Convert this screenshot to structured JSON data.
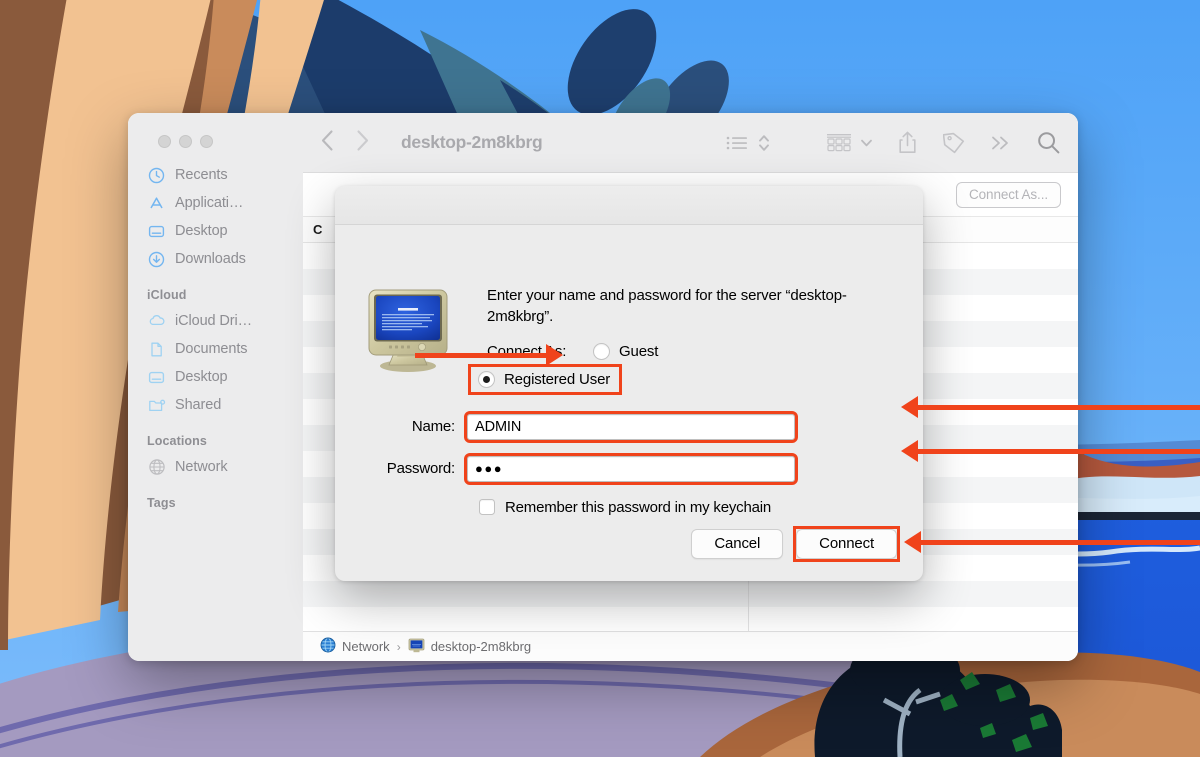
{
  "window": {
    "title": "desktop-2m8kbrg",
    "traffic_lights": [
      "close",
      "minimize",
      "zoom"
    ],
    "toolbar": {
      "back_label": "Back",
      "forward_label": "Forward",
      "view_list_label": "List View",
      "view_sort_label": "Sort",
      "group_label": "Group",
      "share_label": "Share",
      "tag_label": "Tags",
      "more_label": "More",
      "search_label": "Search"
    },
    "connect_as_button": "Connect As...",
    "list_header": "C",
    "path_bar": {
      "root": "Network",
      "separator": "›",
      "current": "desktop-2m8kbrg"
    }
  },
  "sidebar": {
    "items": [
      {
        "label": "Recents",
        "icon": "clock-icon"
      },
      {
        "label": "Applicati…",
        "icon": "appstore-icon"
      },
      {
        "label": "Desktop",
        "icon": "desktop-icon"
      },
      {
        "label": "Downloads",
        "icon": "download-icon"
      }
    ],
    "groups": [
      {
        "title": "iCloud",
        "items": [
          {
            "label": "iCloud Dri…",
            "icon": "cloud-icon"
          },
          {
            "label": "Documents",
            "icon": "document-icon"
          },
          {
            "label": "Desktop",
            "icon": "desktop-icon"
          },
          {
            "label": "Shared",
            "icon": "shared-folder-icon"
          }
        ]
      },
      {
        "title": "Locations",
        "items": [
          {
            "label": "Network",
            "icon": "globe-icon"
          }
        ]
      },
      {
        "title": "Tags",
        "items": []
      }
    ]
  },
  "dialog": {
    "message": "Enter your name and password for the server “desktop-2m8kbrg”.",
    "connect_as_label": "Connect As:",
    "options": [
      {
        "label": "Guest",
        "selected": false
      },
      {
        "label": "Registered User",
        "selected": true
      }
    ],
    "name_label": "Name:",
    "name_value": "ADMIN",
    "password_label": "Password:",
    "password_value": "●●●",
    "keychain_label": "Remember this password in my keychain",
    "keychain_checked": false,
    "cancel_label": "Cancel",
    "connect_label": "Connect",
    "server_icon": "crt-monitor-icon"
  },
  "annotations": {
    "color": "#f0431b",
    "targets": [
      "registered-user-radio",
      "name-field",
      "password-field",
      "connect-button"
    ]
  },
  "colors": {
    "accent_red": "#f0431b",
    "sidebar_bg": "#ececed",
    "toolbar_bg": "#ececed",
    "dialog_bg": "#ececec",
    "wallpaper_sky": "#5aa9f8",
    "wallpaper_sea": "#1d5fe0"
  }
}
